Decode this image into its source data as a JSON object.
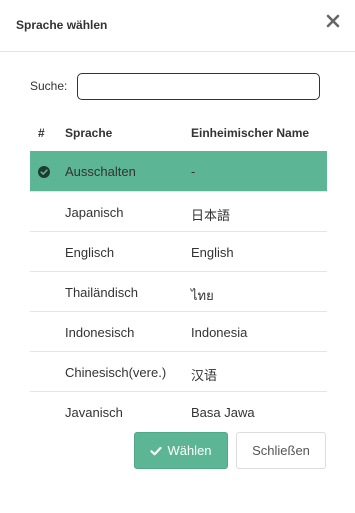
{
  "dialog": {
    "title": "Sprache wählen",
    "close_icon": "close-icon"
  },
  "search": {
    "label": "Suche:",
    "value": "",
    "placeholder": ""
  },
  "table": {
    "headers": {
      "num": "#",
      "language": "Sprache",
      "native": "Einheimischer Name"
    },
    "rows": [
      {
        "language": "Ausschalten",
        "native": "-",
        "selected": true
      },
      {
        "language": "Japanisch",
        "native": "日本語",
        "selected": false
      },
      {
        "language": "Englisch",
        "native": "English",
        "selected": false
      },
      {
        "language": "Thailändisch",
        "native": "ไทย",
        "selected": false
      },
      {
        "language": "Indonesisch",
        "native": "Indonesia",
        "selected": false
      },
      {
        "language": "Chinesisch(vere.)",
        "native": "汉语",
        "selected": false
      },
      {
        "language": "Javanisch",
        "native": "Basa Jawa",
        "selected": false
      }
    ]
  },
  "buttons": {
    "select_label": "Wählen",
    "close_label": "Schließen"
  },
  "colors": {
    "accent": "#5cb594",
    "border": "#e5e5e5"
  }
}
